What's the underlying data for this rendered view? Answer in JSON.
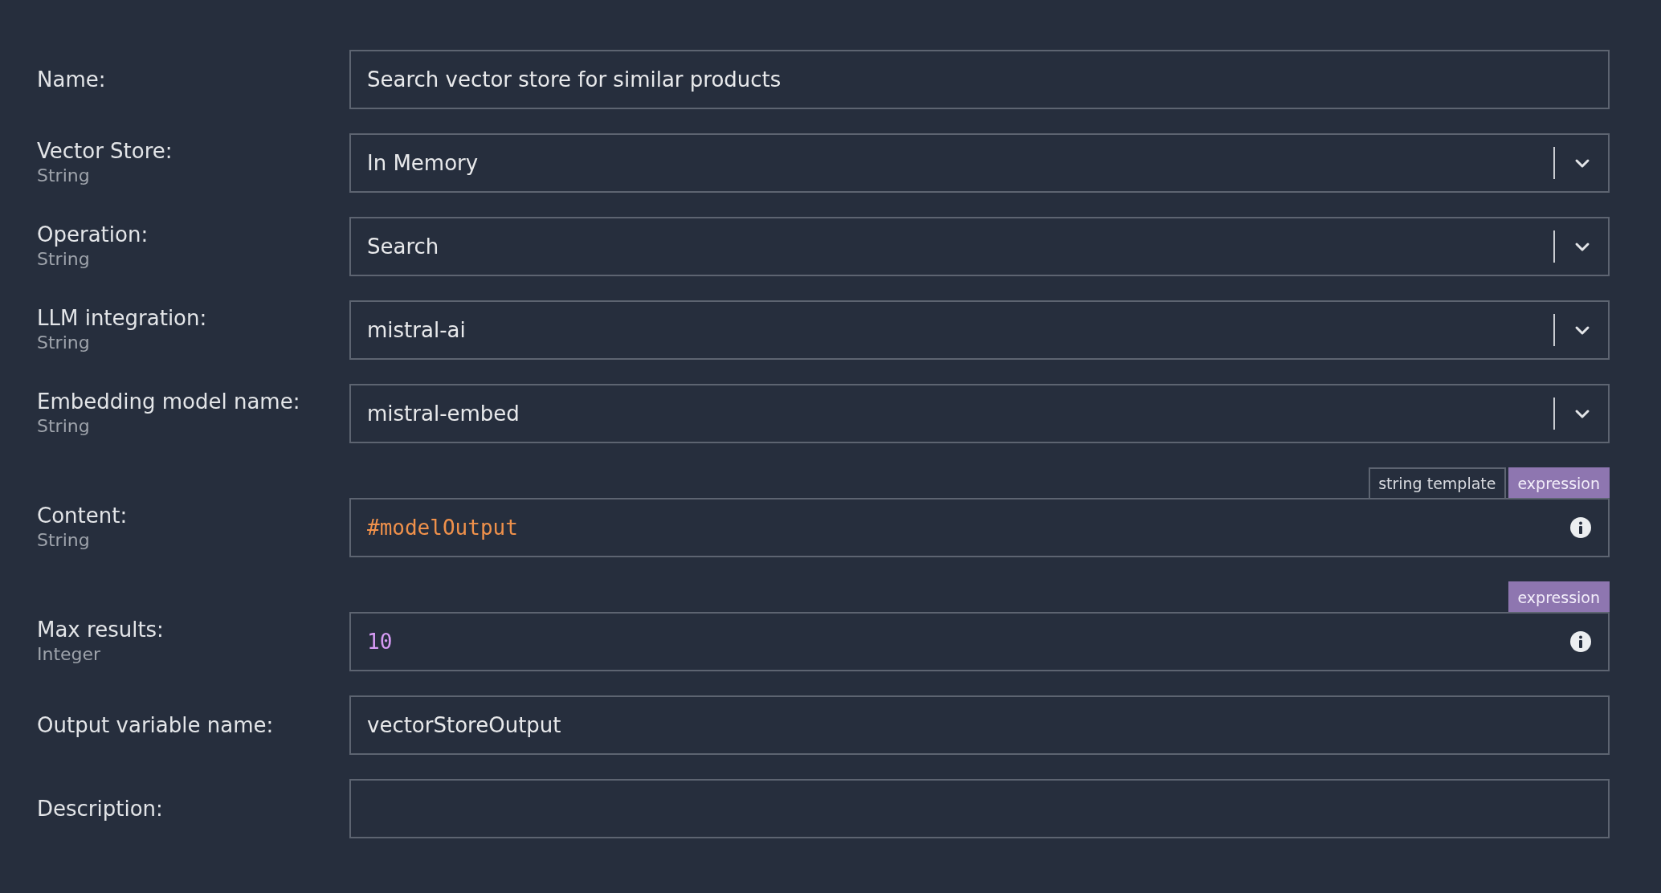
{
  "fields": [
    {
      "kind": "text",
      "label": "Name:",
      "value": "Search vector store for similar products"
    },
    {
      "kind": "select",
      "label": "Vector Store:",
      "type": "String",
      "value": "In Memory"
    },
    {
      "kind": "select",
      "label": "Operation:",
      "type": "String",
      "value": "Search"
    },
    {
      "kind": "select",
      "label": "LLM integration:",
      "type": "String",
      "value": "mistral-ai"
    },
    {
      "kind": "select",
      "label": "Embedding model name:",
      "type": "String",
      "value": "mistral-embed"
    },
    {
      "kind": "expression",
      "label": "Content:",
      "type": "String",
      "modes": [
        {
          "label": "string template",
          "selected": false
        },
        {
          "label": "expression",
          "selected": true
        }
      ],
      "value": "#modelOutput",
      "color": "#f0914b"
    },
    {
      "kind": "expression",
      "label": "Max results:",
      "type": "Integer",
      "modes": [
        {
          "label": "expression",
          "selected": true
        }
      ],
      "value": "10",
      "color": "#d69bf5"
    },
    {
      "kind": "text",
      "label": "Output variable name:",
      "value": "vectorStoreOutput"
    },
    {
      "kind": "text",
      "label": "Description:"
    }
  ]
}
